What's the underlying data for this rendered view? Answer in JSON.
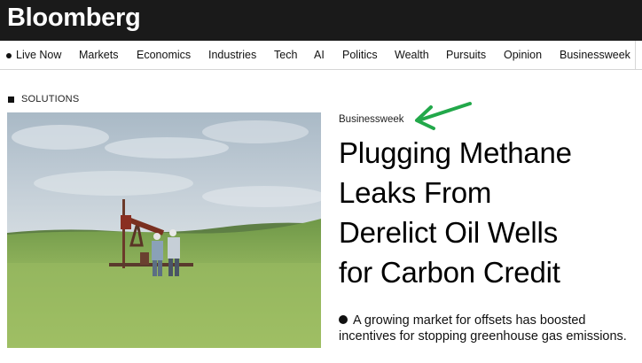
{
  "brand": {
    "name": "Bloomberg"
  },
  "nav": {
    "items": [
      {
        "label": "Live Now"
      },
      {
        "label": "Markets"
      },
      {
        "label": "Economics"
      },
      {
        "label": "Industries"
      },
      {
        "label": "Tech"
      },
      {
        "label": "AI"
      },
      {
        "label": "Politics"
      },
      {
        "label": "Wealth"
      },
      {
        "label": "Pursuits"
      },
      {
        "label": "Opinion"
      },
      {
        "label": "Businessweek"
      }
    ]
  },
  "article": {
    "section": "SOLUTIONS",
    "kicker": "Businessweek",
    "headline_lines": [
      "Plugging Methane",
      "Leaks From",
      "Derelict Oil Wells",
      "for Carbon Credit"
    ],
    "summary": "A growing market for offsets has boosted incentives for stopping greenhouse gas emissions."
  },
  "colors": {
    "topbar": "#1a1a1a",
    "annotation_arrow": "#22a84a",
    "sky": "#b9c7d3",
    "grass": "#8fb35a"
  },
  "icons": {
    "live": "live-dot-icon",
    "section": "section-square-icon",
    "annotation": "green-arrow-icon",
    "summary": "bullet-icon"
  }
}
